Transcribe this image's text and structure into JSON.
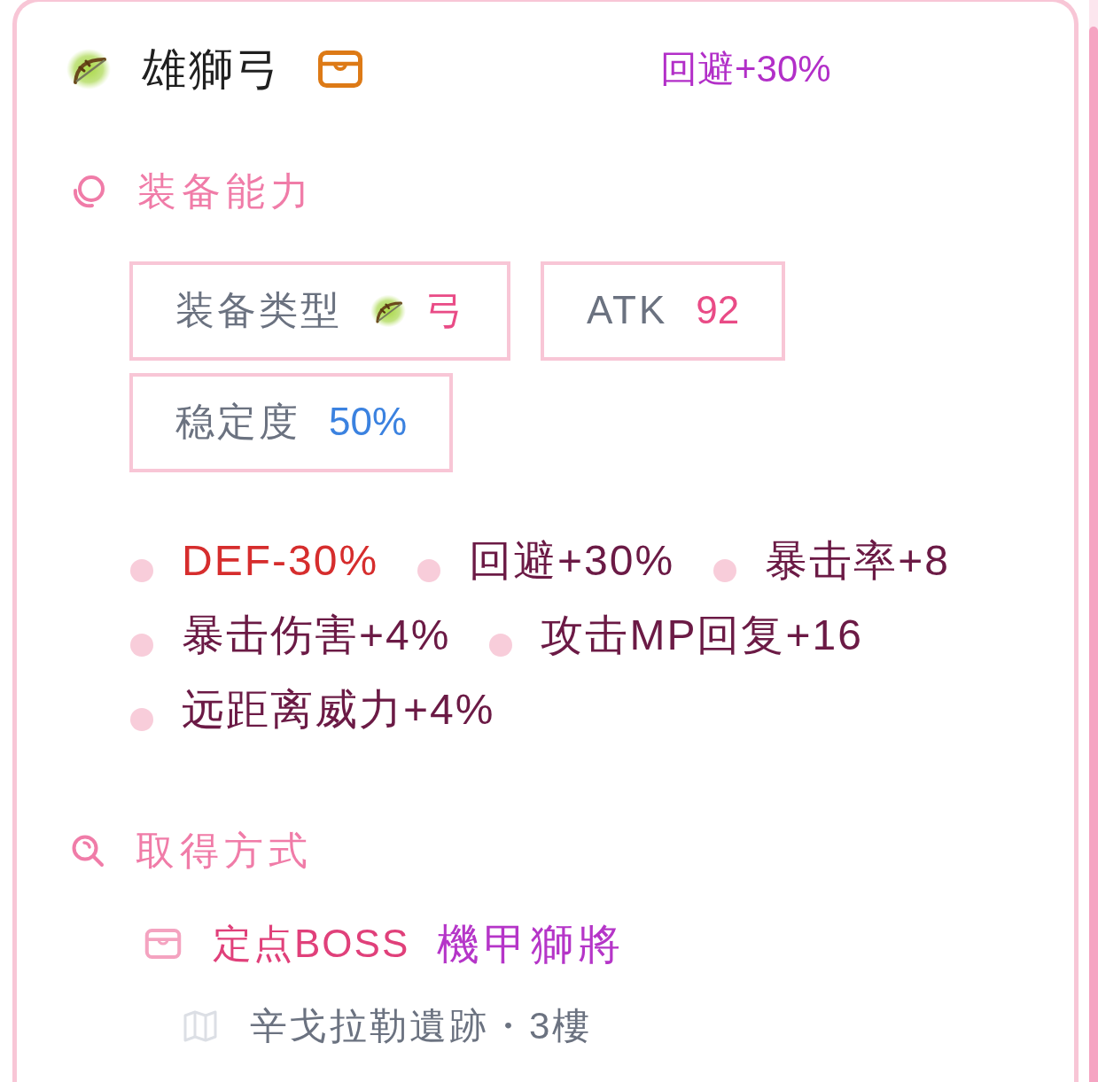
{
  "item": {
    "name": "雄獅弓",
    "highlight": "回避+30%"
  },
  "abilities": {
    "title": "装备能力",
    "stats": [
      {
        "kind": "type",
        "label": "装备类型",
        "value": "弓"
      },
      {
        "kind": "attack",
        "label": "ATK",
        "value": "92"
      },
      {
        "kind": "stability",
        "label": "稳定度",
        "value": "50%"
      }
    ],
    "effects": [
      {
        "text": "DEF-30%",
        "color": "#d62d2d"
      },
      {
        "text": "回避+30%",
        "color": "#6b1a45"
      },
      {
        "text": "暴击率+8",
        "color": "#6b1a45"
      },
      {
        "text": "暴击伤害+4%",
        "color": "#6b1a45"
      },
      {
        "text": "攻击MP回复+16",
        "color": "#6b1a45"
      },
      {
        "text": "远距离威力+4%",
        "color": "#6b1a45"
      }
    ]
  },
  "acquisition": {
    "title": "取得方式",
    "sources": [
      {
        "type": "定点BOSS",
        "name": "機甲獅將",
        "location": "辛戈拉勒遺跡・3樓"
      }
    ]
  }
}
